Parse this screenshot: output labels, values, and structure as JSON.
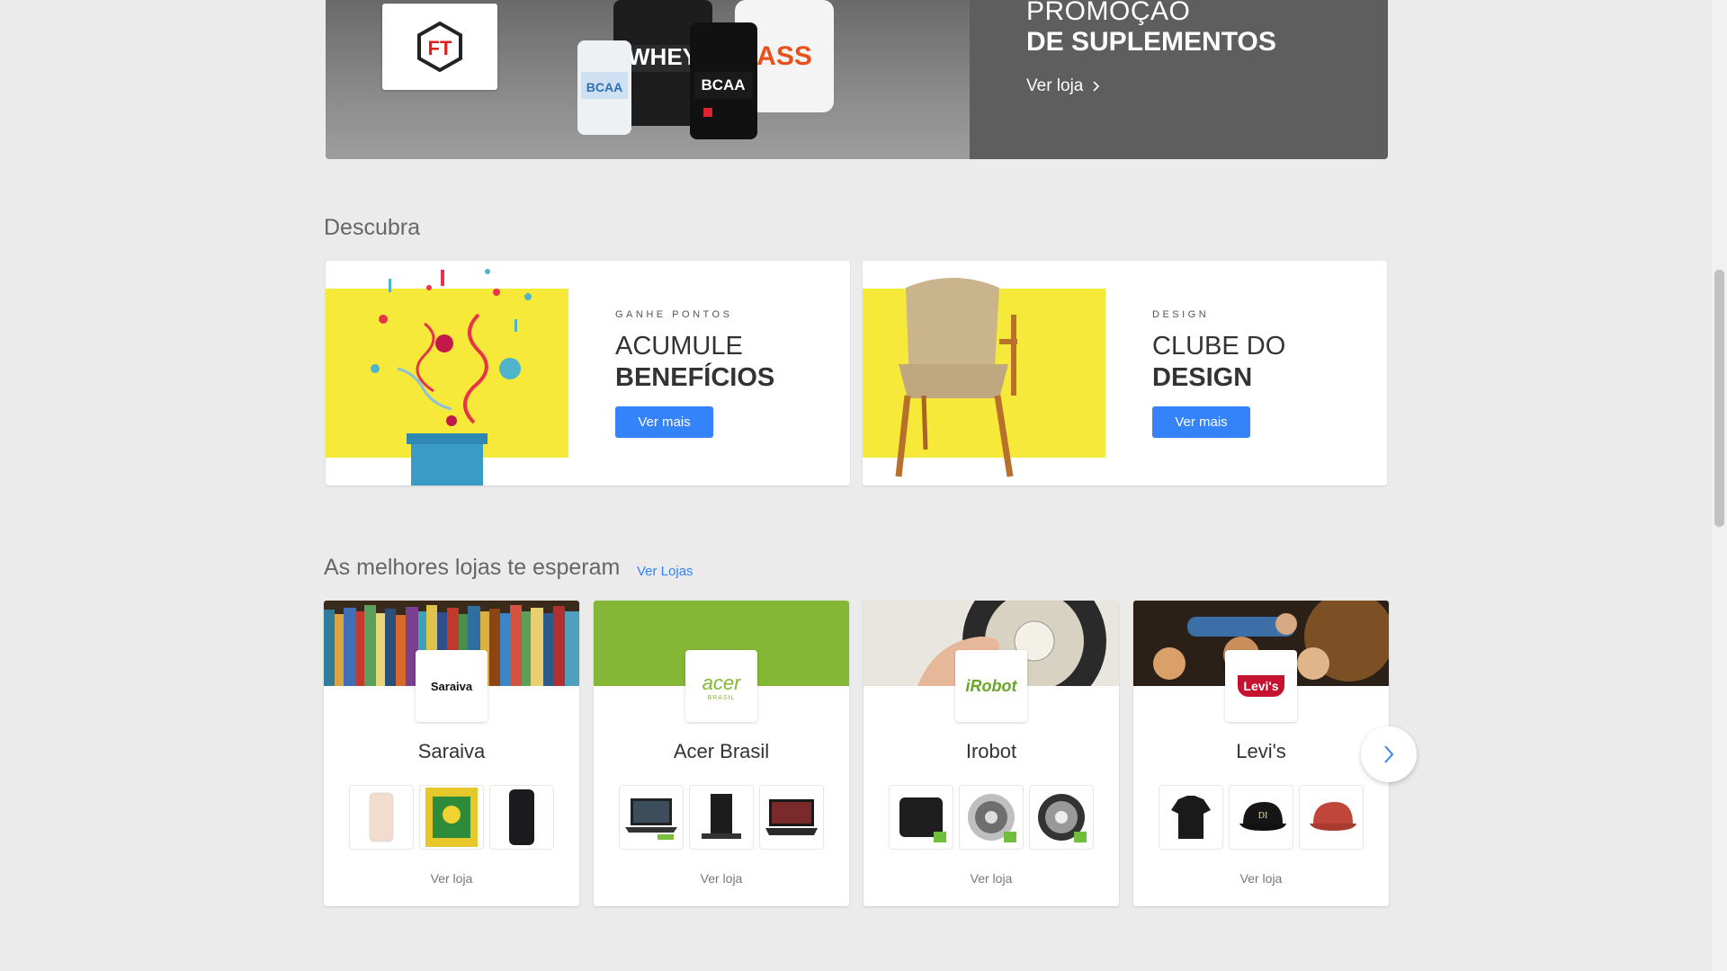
{
  "promo": {
    "title_line1": "PROMOÇÃO",
    "title_line2": "DE SUPLEMENTOS",
    "link_label": "Ver loja",
    "logo_text": "FT"
  },
  "discover": {
    "title": "Descubra",
    "cards": [
      {
        "kicker": "GANHE PONTOS",
        "title_line1": "ACUMULE",
        "title_line2": "BENEFÍCIOS",
        "button": "Ver mais"
      },
      {
        "kicker": "DESIGN",
        "title_line1": "CLUBE DO",
        "title_line2": "DESIGN",
        "button": "Ver mais"
      }
    ]
  },
  "stores": {
    "title": "As melhores lojas te esperam",
    "link": "Ver Lojas",
    "items": [
      {
        "name": "Saraiva",
        "logo": "Saraiva",
        "link": "Ver loja"
      },
      {
        "name": "Acer Brasil",
        "logo": "acer",
        "logo_sub": "BRASIL",
        "link": "Ver loja"
      },
      {
        "name": "Irobot",
        "logo": "iRobot",
        "link": "Ver loja"
      },
      {
        "name": "Levi's",
        "logo": "Levi's",
        "link": "Ver loja"
      }
    ]
  },
  "colors": {
    "accent": "#3483fa",
    "banner_yellow": "#f7e93a",
    "acer_green": "#83b735",
    "levis_red": "#c41230"
  }
}
